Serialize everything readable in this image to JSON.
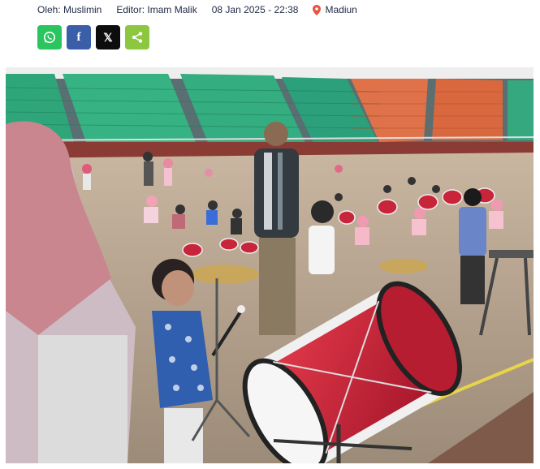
{
  "article": {
    "author_label": "Oleh: Muslimin",
    "editor_label": "Editor: Imam Malik",
    "datetime": "08 Jan 2025 - 22:38",
    "location": "Madiun"
  },
  "share": {
    "buttons": [
      {
        "name": "whatsapp",
        "icon": "whatsapp-icon",
        "color": "#2ac55e"
      },
      {
        "name": "facebook",
        "icon": "facebook-icon",
        "glyph": "f",
        "color": "#3b5ea8"
      },
      {
        "name": "x",
        "icon": "x-icon",
        "glyph": "𝕏",
        "color": "#0d0d0d"
      },
      {
        "name": "share",
        "icon": "share-icon",
        "color": "#8dc63f"
      }
    ]
  },
  "colors": {
    "pin": "#e8533f"
  }
}
